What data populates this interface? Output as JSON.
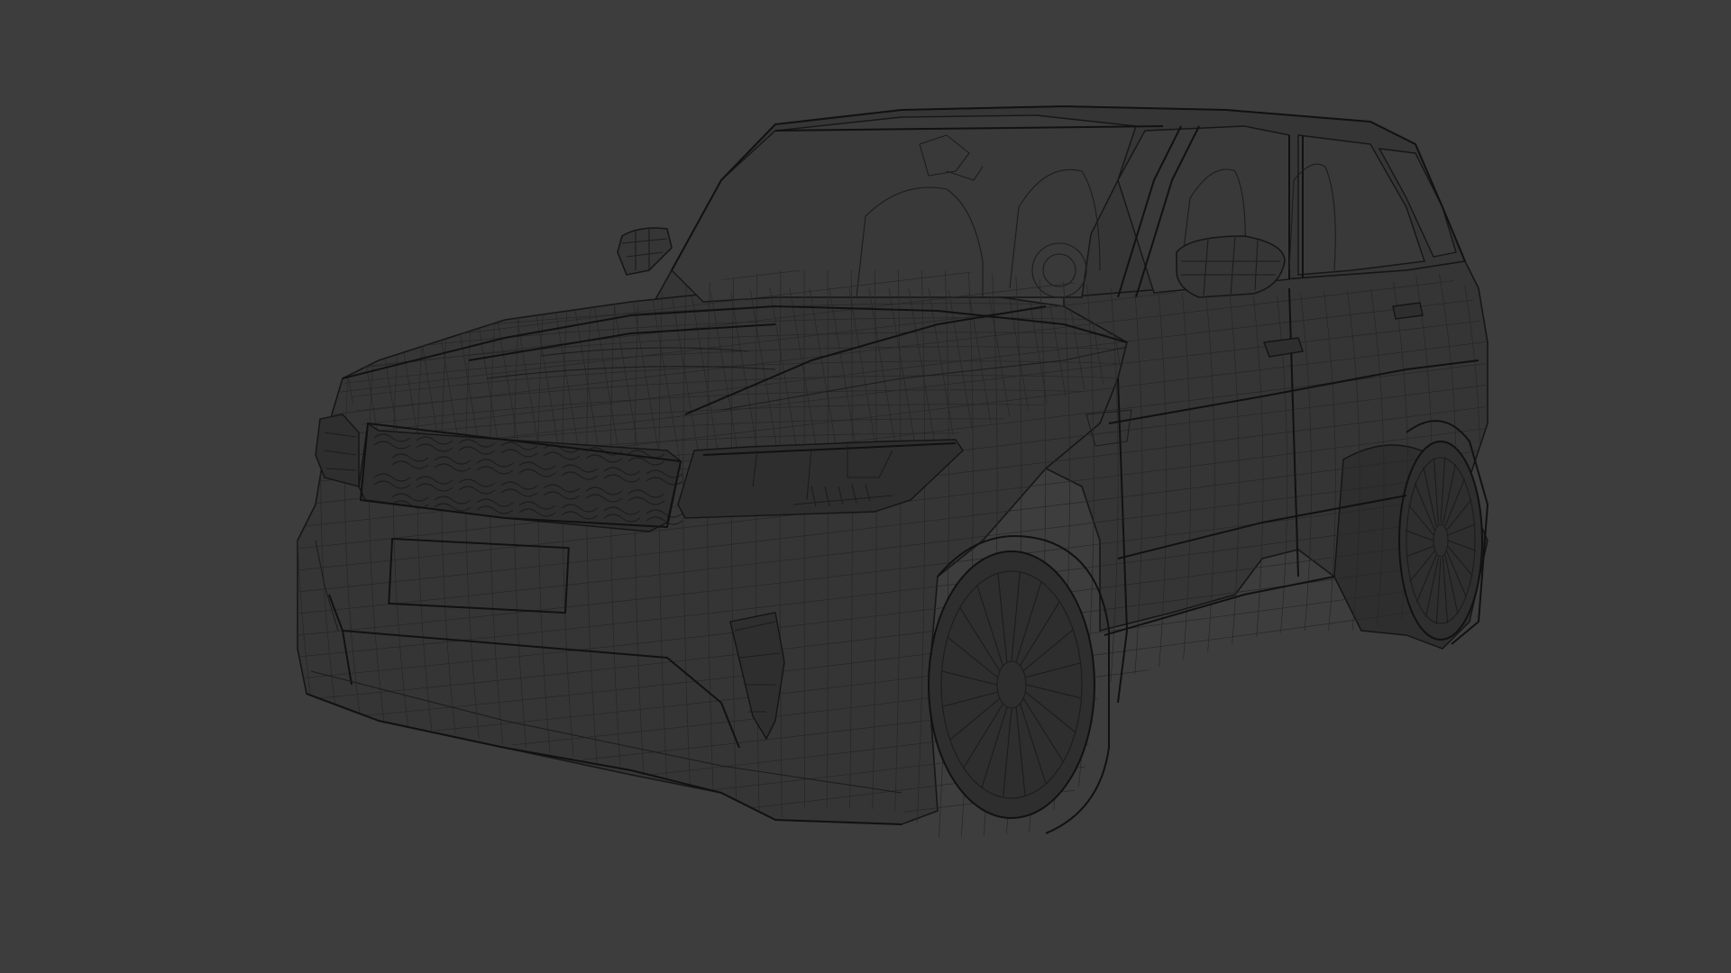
{
  "viewport": {
    "background_color": "#3d3d3d",
    "wire_color": "#1c1c1c",
    "mode": "wireframe"
  },
  "model": {
    "subject": "suv-wireframe",
    "wheels": 2,
    "spokes_per_wheel": 20
  }
}
